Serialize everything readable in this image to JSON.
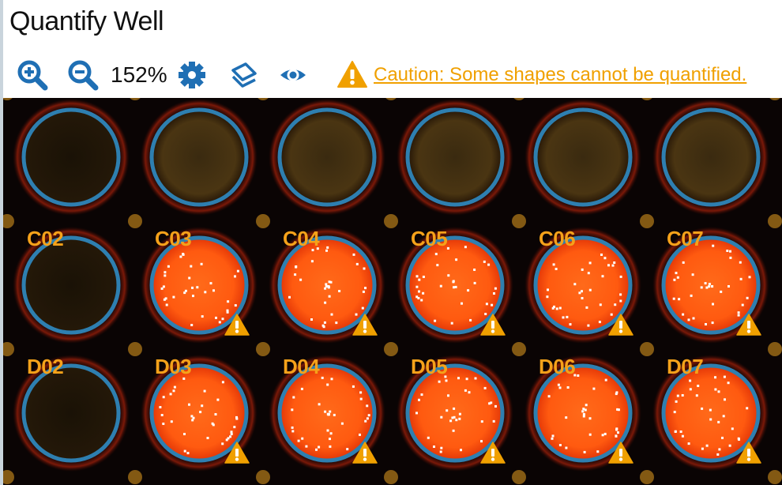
{
  "title": "Quantify Well",
  "toolbar": {
    "zoom_level": "152%",
    "zoom_in_icon": "zoom-in-icon",
    "zoom_out_icon": "zoom-out-icon",
    "settings_icon": "gear-icon",
    "layers_icon": "layers-icon",
    "visibility_icon": "eye-icon",
    "caution_text": "Caution: Some shapes cannot be quantified."
  },
  "colors": {
    "accent": "#1f6fb4",
    "caution": "#f0a000",
    "well_ring": "#2e7fb0",
    "label": "#f5a21a"
  },
  "plate": {
    "rows": [
      {
        "wells": [
          {
            "label": "",
            "lit": false,
            "warning": false
          },
          {
            "label": "",
            "lit": false,
            "warning": false
          },
          {
            "label": "",
            "lit": false,
            "warning": false
          },
          {
            "label": "",
            "lit": false,
            "warning": false
          },
          {
            "label": "",
            "lit": false,
            "warning": false
          },
          {
            "label": "",
            "lit": false,
            "warning": false
          }
        ]
      },
      {
        "wells": [
          {
            "label": "C02",
            "lit": false,
            "warning": false
          },
          {
            "label": "C03",
            "lit": true,
            "warning": true
          },
          {
            "label": "C04",
            "lit": true,
            "warning": true
          },
          {
            "label": "C05",
            "lit": true,
            "warning": true
          },
          {
            "label": "C06",
            "lit": true,
            "warning": true
          },
          {
            "label": "C07",
            "lit": true,
            "warning": true
          }
        ]
      },
      {
        "wells": [
          {
            "label": "D02",
            "lit": false,
            "warning": false
          },
          {
            "label": "D03",
            "lit": true,
            "warning": true
          },
          {
            "label": "D04",
            "lit": true,
            "warning": true
          },
          {
            "label": "D05",
            "lit": true,
            "warning": true
          },
          {
            "label": "D06",
            "lit": true,
            "warning": true
          },
          {
            "label": "D07",
            "lit": true,
            "warning": true
          }
        ]
      }
    ]
  }
}
